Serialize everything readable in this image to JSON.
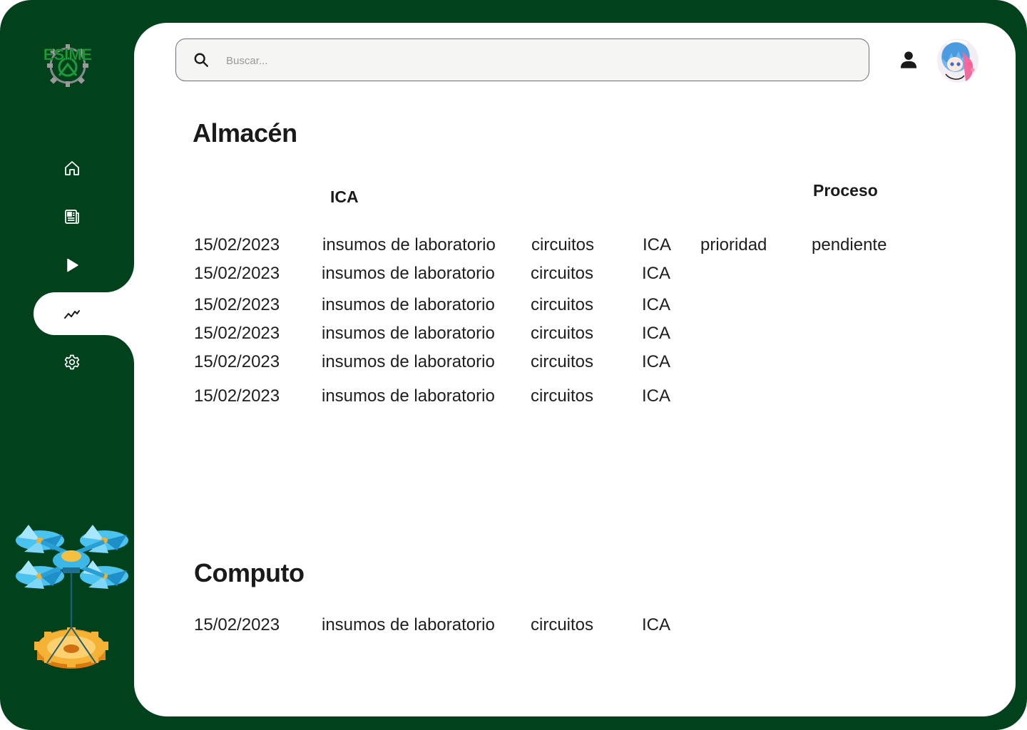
{
  "sidebar": {
    "logo_text": "ESIME",
    "nav": [
      {
        "name": "nav-home",
        "icon": "home-icon"
      },
      {
        "name": "nav-documents",
        "icon": "document-icon"
      },
      {
        "name": "nav-play",
        "icon": "play-icon"
      },
      {
        "name": "nav-analytics",
        "icon": "trend-line-icon",
        "active": true
      },
      {
        "name": "nav-settings",
        "icon": "gear-icon"
      }
    ]
  },
  "header": {
    "search_placeholder": "Buscar...",
    "user_icon": "user-icon",
    "avatar": "avatar"
  },
  "almacen": {
    "title": "Almacén",
    "headers": {
      "area": "ICA",
      "process": "Proceso"
    },
    "rows": [
      {
        "date": "15/02/2023",
        "description": "insumos de laboratorio",
        "category": "circuitos",
        "area": "ICA",
        "priority": "prioridad",
        "status": "pendiente"
      },
      {
        "date": "15/02/2023",
        "description": "insumos de laboratorio",
        "category": "circuitos",
        "area": "ICA"
      },
      {
        "date": "15/02/2023",
        "description": "insumos de laboratorio",
        "category": "circuitos",
        "area": "ICA"
      },
      {
        "date": "15/02/2023",
        "description": "insumos de laboratorio",
        "category": "circuitos",
        "area": "ICA"
      },
      {
        "date": "15/02/2023",
        "description": "insumos de laboratorio",
        "category": "circuitos",
        "area": "ICA"
      },
      {
        "date": "15/02/2023",
        "description": "insumos de laboratorio",
        "category": "circuitos",
        "area": "ICA"
      }
    ]
  },
  "computo": {
    "title": "Computo",
    "rows": [
      {
        "date": "15/02/2023",
        "description": "insumos de laboratorio",
        "category": "circuitos",
        "area": "ICA"
      }
    ]
  },
  "colors": {
    "sidebar_green": "#01411c",
    "content_bg": "#ffffff",
    "logo_green": "#1f9a3a",
    "gear_orange": "#f0a020",
    "propeller_blue": "#3bb8e8"
  }
}
